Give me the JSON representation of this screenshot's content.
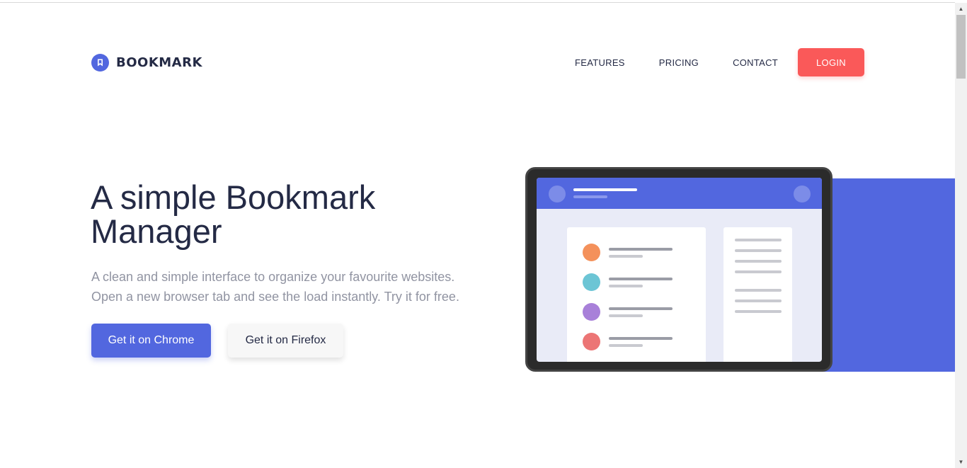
{
  "brand": {
    "name": "BOOKMARK",
    "icon": "bookmark-logo-icon",
    "color": "#5267df"
  },
  "nav": {
    "features": "FEATURES",
    "pricing": "PRICING",
    "contact": "CONTACT",
    "login": "LOGIN",
    "login_color": "#fa5959"
  },
  "hero": {
    "title": "A simple Bookmark Manager",
    "description": "A clean and simple interface to organize your favourite websites. Open a new browser tab and see the load instantly. Try it for free.",
    "chrome_button": "Get it on Chrome",
    "firefox_button": "Get it on Firefox",
    "accent_color": "#5267df"
  },
  "illustration": {
    "icon": "tablet-bookmark-illustration",
    "dot_colors": [
      "#f4915b",
      "#6cc5d5",
      "#a880d9",
      "#ec7575"
    ]
  },
  "scrollbar": {
    "up_icon": "scroll-up-arrow-icon",
    "down_icon": "scroll-down-arrow-icon"
  }
}
